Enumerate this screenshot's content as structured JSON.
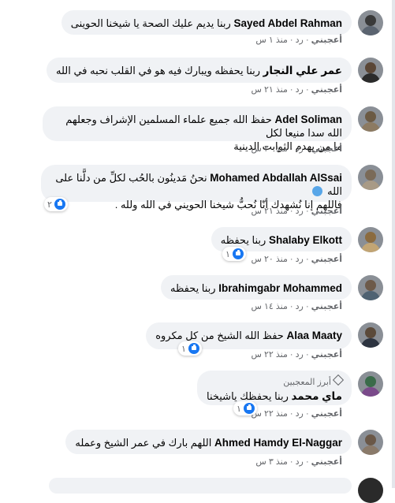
{
  "actions": {
    "like": "أعجبني",
    "reply": "رد",
    "separator": "·"
  },
  "comments": [
    {
      "name": "Sayed Abdel Rahman",
      "text": "ربنا يديم عليك الصحة يا شيخنا الحوينى",
      "time": "منذ ١ س"
    },
    {
      "name": "عمر علي النجار",
      "text": "ربنا يحفظه ويبارك فيه هو في القلب نحبه في الله",
      "time": "منذ ٢١ س"
    },
    {
      "name": "Adel Soliman",
      "text": "حفظ الله جميع علماء المسلمين الإشراف وجعلهم الله سدا منيعا لكل",
      "text2": "ما من يهدم الثوابت الدينية",
      "time": "منذ ٢٠ س"
    },
    {
      "name": "Mohamed Abdallah AlSsai",
      "text": "نحنُ مَدينُون بالحُب لكلِّ من دلَّنا على الله",
      "text2": "فاللهم إنا نُشهدك أنّا نُحبُّ شيخنا الحويني في الله ولله .",
      "time": "منذ ٢١ س",
      "reactions": "٢"
    },
    {
      "name": "Shalaby Elkott",
      "text": "ربنا يحفظه",
      "time": "منذ ٢٠ س",
      "reactions": "١"
    },
    {
      "name": "Ibrahimgabr Mohammed",
      "text": "ربنا يحفظه",
      "time": "منذ ١٤ س"
    },
    {
      "name": "Alaa Maaty",
      "text": "حفظ الله الشيخ من كل مكروه",
      "time": "منذ ٢٢ س",
      "reactions": "١"
    },
    {
      "badge": "أبرز المعجبين",
      "name": "ماي محمد",
      "text": "ربنا يحفظك ياشيخنا",
      "time": "منذ ٢٢ س",
      "reactions": "١"
    },
    {
      "name": "Ahmed Hamdy El-Naggar",
      "text": "اللهم بارك في عمر الشيخ وعمله",
      "time": "منذ ٣ س"
    }
  ],
  "colors": {
    "bubble": "#f0f2f5",
    "like_blue": "#1877f2",
    "heart": "#58a6e8",
    "meta_gray": "#65676b"
  }
}
